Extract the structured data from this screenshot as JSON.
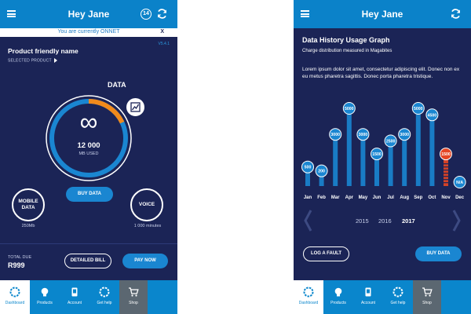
{
  "colors": {
    "bg": "#1b2456",
    "header": "#0b82c9",
    "accent": "#1a86d1",
    "orange": "#f08a1c",
    "red": "#e54624",
    "shop": "#5b6771"
  },
  "left": {
    "header": {
      "title": "Hey Jane",
      "badge": "14",
      "menu_icon": "hamburger-icon",
      "refresh_icon": "refresh-icon"
    },
    "notice": {
      "text": "You are currently ONNET",
      "close": "X"
    },
    "version": "V5.4.1",
    "product": {
      "name": "Product friendly name",
      "selected": "SELECTED PRODUCT"
    },
    "data": {
      "label": "DATA",
      "used_value": "12 000",
      "used_unit": "MB USED",
      "usage_fraction": 0.18
    },
    "buy_data": "BUY DATA",
    "mobile_data": {
      "label_line1": "MOBILE",
      "label_line2": "DATA",
      "value": "250Mb"
    },
    "voice": {
      "label": "VOICE",
      "value": "1 000 minutes"
    },
    "billing": {
      "total_label": "TOTAL DUE",
      "amount": "R999",
      "detailed_bill": "DETAILED BILL",
      "pay_now": "PAY NOW"
    }
  },
  "right": {
    "header": {
      "title": "Hey Jane"
    },
    "graph": {
      "title": "Data History Usage Graph",
      "subtitle": "Charge distribution measured in Magabites",
      "description": "Lorem ipsum dolor sit amet, consectetur adipiscing elit. Donec non ex eu metus pharetra sagittis. Donec porta pharetra tristique."
    },
    "years": [
      "2015",
      "2016",
      "2017"
    ],
    "active_year": "2017",
    "log_fault": "LOG A FAULT",
    "buy_data": "BUY DATA"
  },
  "nav": [
    {
      "label": "Dashboard",
      "icon": "dashboard-icon",
      "selected": true
    },
    {
      "label": "Products",
      "icon": "lightbulb-icon",
      "selected": false
    },
    {
      "label": "Account",
      "icon": "account-icon",
      "selected": false
    },
    {
      "label": "Get help",
      "icon": "help-icon",
      "selected": false
    },
    {
      "label": "Shop",
      "icon": "cart-icon",
      "selected": false
    }
  ],
  "chart_data": {
    "type": "bar",
    "categories": [
      "Jan",
      "Feb",
      "Mar",
      "Apr",
      "May",
      "Jun",
      "Jul",
      "Aug",
      "Sep",
      "Oct",
      "Nov",
      "Dec"
    ],
    "values": [
      500,
      200,
      3000,
      5000,
      3000,
      1500,
      2500,
      3000,
      5000,
      4500,
      1500,
      null
    ],
    "labels": [
      "500",
      "200",
      "3000",
      "5000",
      "3000",
      "1500",
      "2500",
      "3000",
      "5000",
      "4500",
      "1500",
      "N/A"
    ],
    "highlight_index": 10,
    "ylim": [
      0,
      5000
    ]
  }
}
